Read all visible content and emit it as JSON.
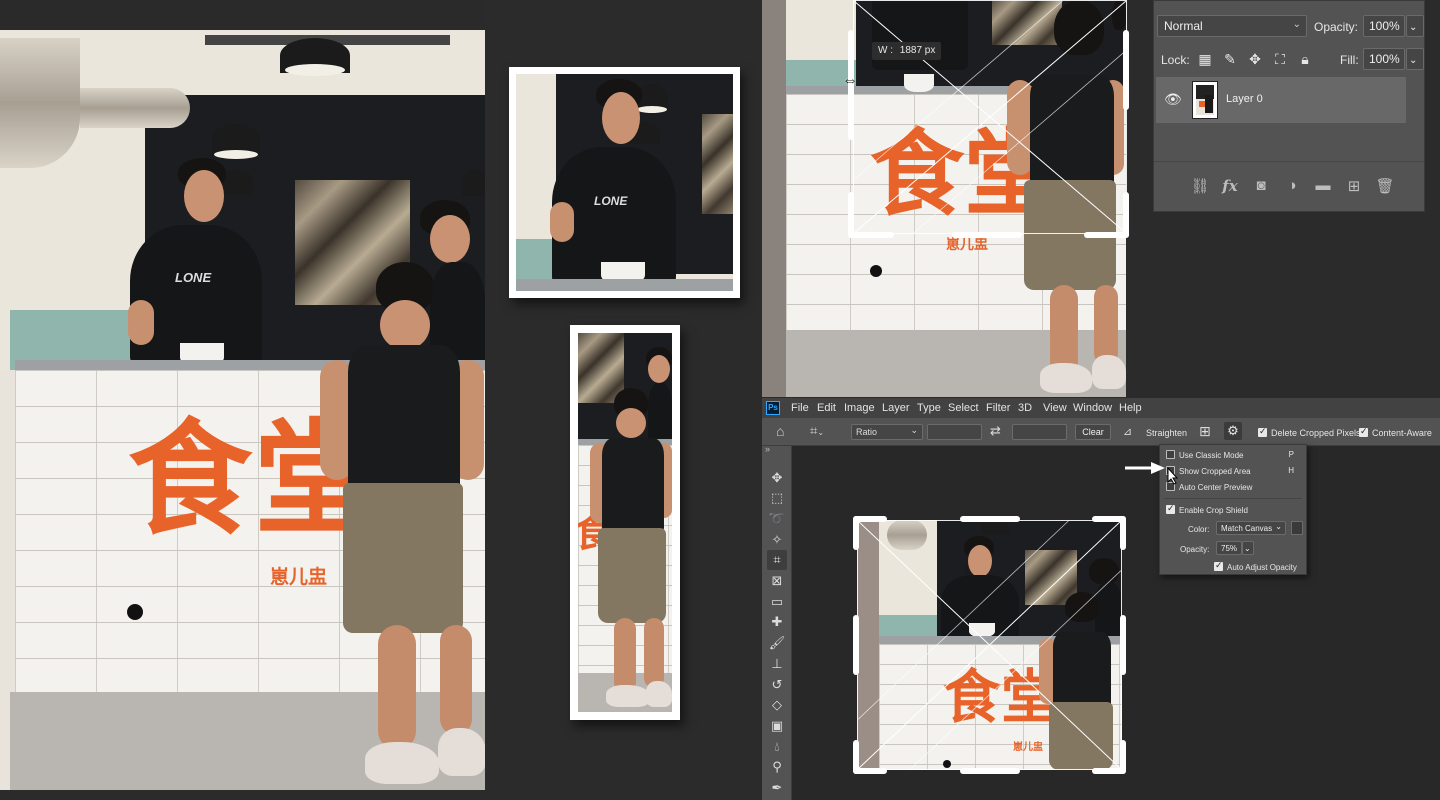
{
  "layers_panel": {
    "blend_mode": "Normal",
    "opacity_label": "Opacity:",
    "opacity_value": "100%",
    "lock_label": "Lock:",
    "fill_label": "Fill:",
    "fill_value": "100%",
    "layer_name": "Layer 0",
    "icons": [
      "eye-icon",
      "link-icon",
      "fx-icon",
      "mask-icon",
      "adjustment-icon",
      "folder-icon",
      "new-layer-icon",
      "trash-icon"
    ]
  },
  "dimension_tooltip": {
    "label": "W :",
    "value": "1887 px"
  },
  "menubar": {
    "app_badge": "Ps",
    "items": [
      "File",
      "Edit",
      "Image",
      "Layer",
      "Type",
      "Select",
      "Filter",
      "3D",
      "View",
      "Window",
      "Help"
    ]
  },
  "options_bar": {
    "ratio_label": "Ratio",
    "clear_label": "Clear",
    "straighten_label": "Straighten",
    "delete_cropped_label": "Delete Cropped Pixels",
    "content_aware_label": "Content-Aware",
    "delete_cropped_checked": true,
    "content_aware_checked": true
  },
  "crop_settings": {
    "use_classic_mode": {
      "label": "Use Classic Mode",
      "key": "P",
      "checked": false
    },
    "show_cropped_area": {
      "label": "Show Cropped Area",
      "key": "H",
      "checked": false
    },
    "auto_center_preview": {
      "label": "Auto Center Preview",
      "checked": false
    },
    "enable_crop_shield": {
      "label": "Enable Crop Shield",
      "checked": true
    },
    "color_label": "Color:",
    "color_value": "Match Canvas",
    "opacity_label": "Opacity:",
    "opacity_value": "75%",
    "auto_adjust_opacity": {
      "label": "Auto Adjust Opacity",
      "checked": true
    }
  },
  "photo_text": {
    "sign": "食堂",
    "sign_sub": "崽儿盅",
    "shirt_print": "LONE"
  },
  "colors": {
    "ps_panel": "#535353",
    "ps_bar": "#424242",
    "canvas_bg": "#282828",
    "sign_orange": "#e8632a",
    "ps_blue": "#31a8ff"
  }
}
